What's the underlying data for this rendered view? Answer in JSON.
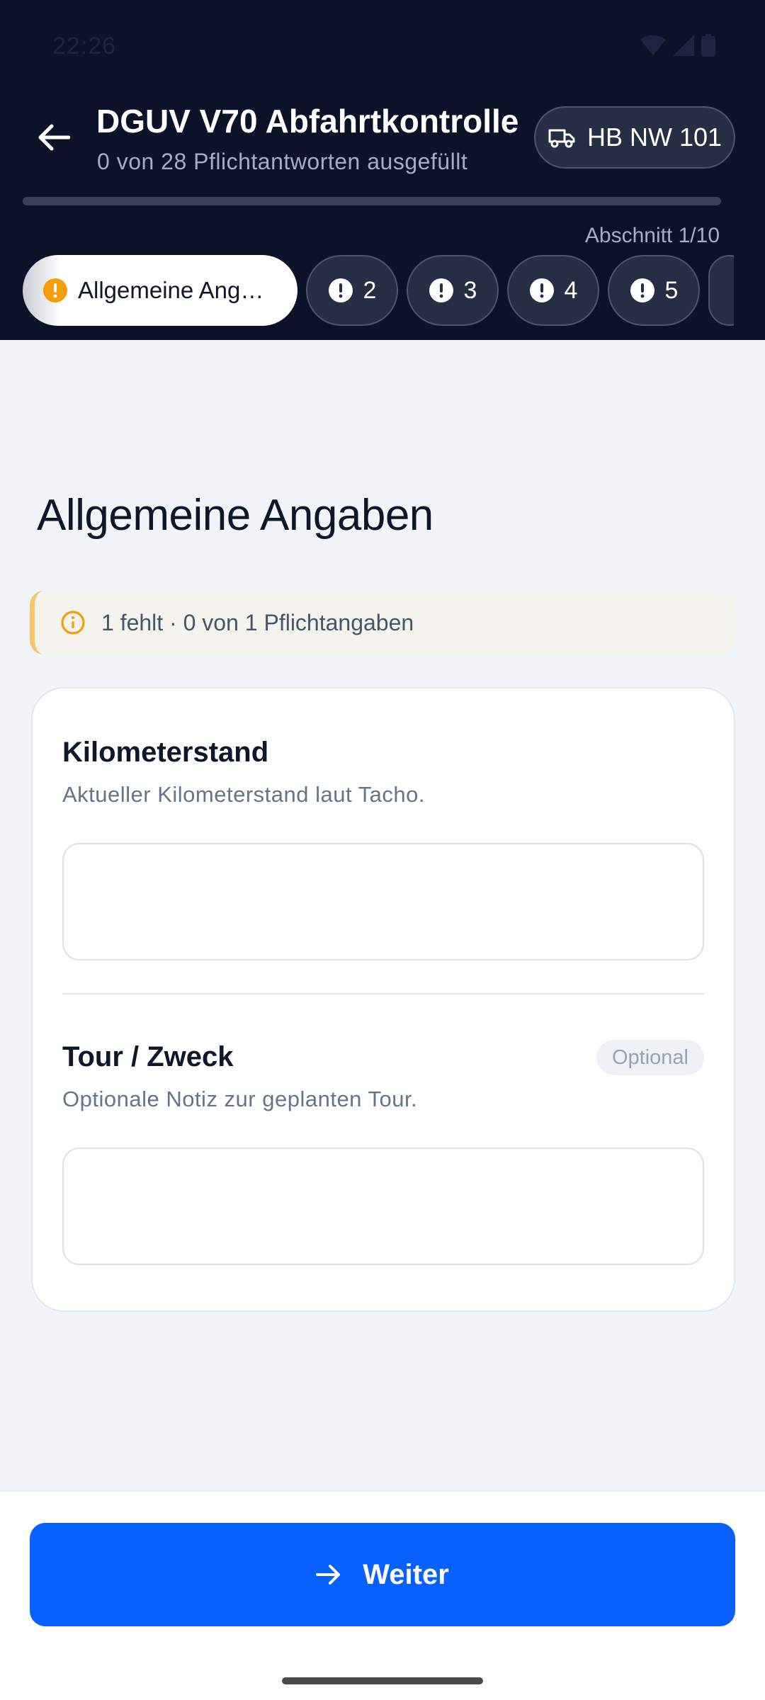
{
  "status_bar": {
    "time": "22:26"
  },
  "header": {
    "title": "DGUV V70 Abfahrtkontrolle",
    "subtitle": "0 von 28 Pflichtantworten ausgefüllt",
    "vehicle": "HB NW 101",
    "progress_fraction": 0,
    "section_counter": "Abschnitt 1/10"
  },
  "tabs": [
    {
      "label": "Allgemeine Ang…",
      "state": "active",
      "icon": "warning-circle-icon"
    },
    {
      "label": "2",
      "state": "incomplete",
      "icon": "exclamation-circle-icon"
    },
    {
      "label": "3",
      "state": "incomplete",
      "icon": "exclamation-circle-icon"
    },
    {
      "label": "4",
      "state": "incomplete",
      "icon": "exclamation-circle-icon"
    },
    {
      "label": "5",
      "state": "incomplete",
      "icon": "exclamation-circle-icon"
    }
  ],
  "section": {
    "heading": "Allgemeine Angaben",
    "notice": "1 fehlt · 0 von 1 Pflichtangaben"
  },
  "fields": {
    "odometer": {
      "label": "Kilometerstand",
      "help": "Aktueller Kilometerstand laut Tacho.",
      "value": "",
      "placeholder": ""
    },
    "tour": {
      "label": "Tour / Zweck",
      "help": "Optionale Notiz zur geplanten Tour.",
      "badge": "Optional",
      "value": "",
      "placeholder": ""
    }
  },
  "footer": {
    "next_label": "Weiter"
  },
  "colors": {
    "header_bg": "#0c1328",
    "primary": "#0760ff",
    "warning": "#f59e0b",
    "page_bg": "#f1f5f9"
  }
}
